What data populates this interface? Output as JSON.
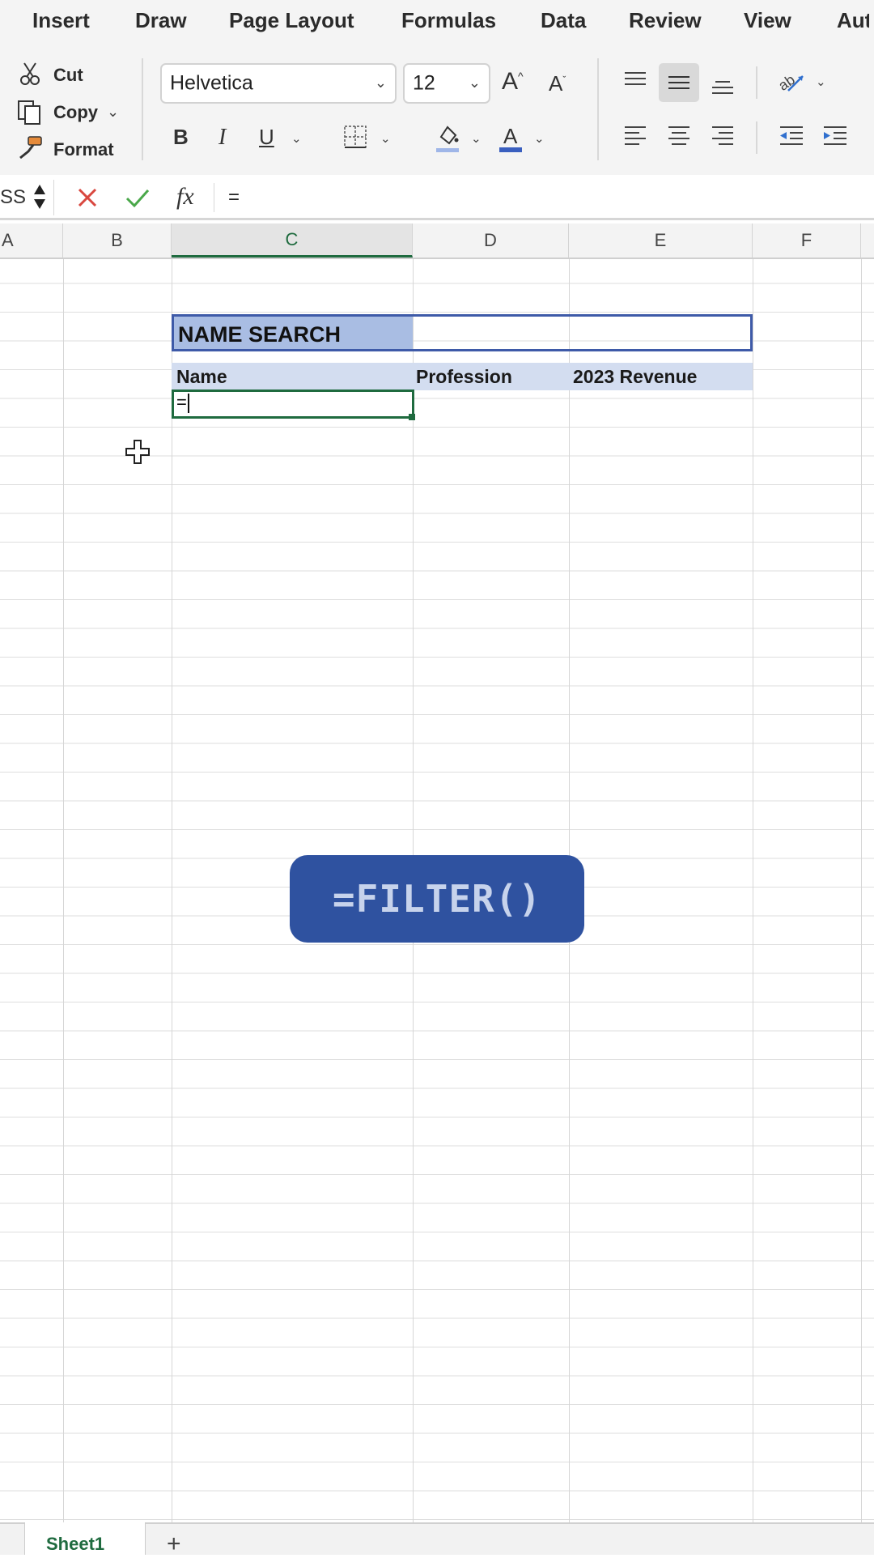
{
  "ribbon": {
    "tabs": [
      "Insert",
      "Draw",
      "Page Layout",
      "Formulas",
      "Data",
      "Review",
      "View",
      "Auto"
    ],
    "clipboard": {
      "cut_label": "Cut",
      "copy_label": "Copy",
      "format_label": "Format"
    },
    "font": {
      "family": "Helvetica",
      "size": "12"
    },
    "format_buttons": {
      "bold": "B",
      "italic": "I",
      "underline": "U"
    },
    "colors": {
      "font_color_bar": "#3a5fbf",
      "fill_color_bar": "#9fb6e8"
    }
  },
  "formula_bar": {
    "name_box": "SS",
    "cancel_icon": "x-icon",
    "enter_icon": "check-icon",
    "fx_label": "fx",
    "content": "="
  },
  "columns": [
    "A",
    "B",
    "C",
    "D",
    "E",
    "F"
  ],
  "selected_column": "C",
  "sheet": {
    "search_title": "NAME SEARCH",
    "headers": [
      "Name",
      "Profession",
      "2023 Revenue"
    ],
    "active_cell_value": "="
  },
  "overlay": {
    "badge_text": "=FILTER()"
  },
  "sheet_tabs": {
    "active": "Sheet1",
    "add_label": "+"
  },
  "theme": {
    "title_fill": "#a9bde3",
    "header_fill": "#d3ddf0",
    "box_border": "#3e5aa8",
    "active_border": "#1f6b3f",
    "badge_fill": "#2f52a0"
  }
}
